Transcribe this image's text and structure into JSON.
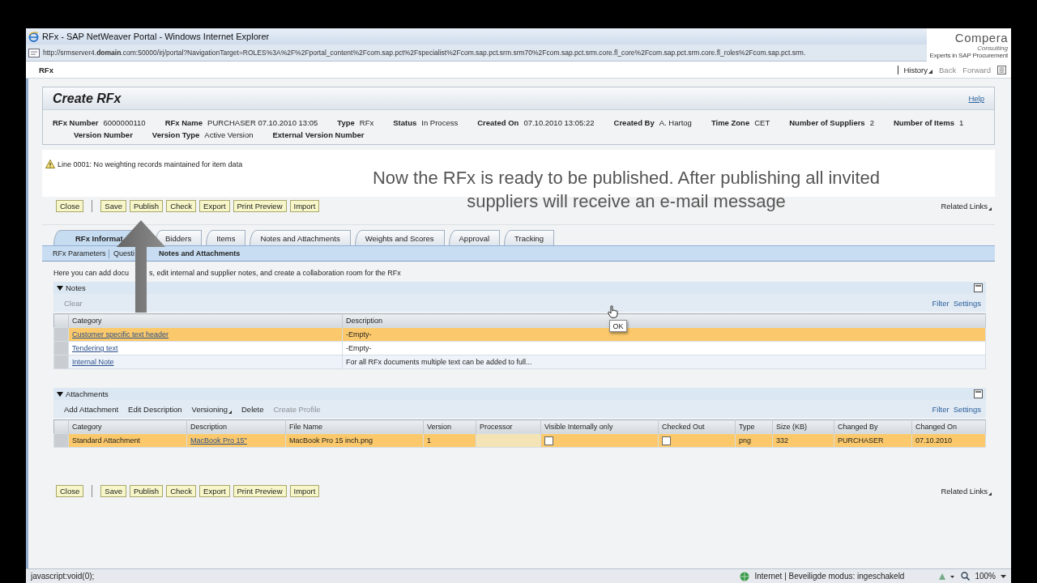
{
  "browser": {
    "title": "RFx - SAP NetWeaver Portal - Windows Internet Explorer",
    "address": "http://srmserver4.**domain**.com:50000/irj/portal?NavigationTarget=ROLES%3A%2F%2Fportal_content%2Fcom.sap.pct%2Fspecialist%2Fcom.sap.pct.srm.srm70%2Fcom.sap.pct.srm.core.fl_core%2Fcom.sap.pct.srm.core.fl_roles%2Fcom.sap.pct.srm.",
    "status_text": "javascript:void(0);",
    "zone": "Internet | Beveiligde modus: ingeschakeld",
    "zoom": "100%"
  },
  "logo": {
    "name": "Compera",
    "tagline": "Consulting",
    "subline": "Experts in SAP Procurement"
  },
  "portal": {
    "page": "RFx",
    "nav": [
      {
        "label": "History",
        "kind": "menu",
        "disabled": false
      },
      {
        "label": "Back",
        "kind": "link",
        "disabled": true
      },
      {
        "label": "Forward",
        "kind": "link",
        "disabled": true
      }
    ]
  },
  "header": {
    "title": "Create RFx",
    "help": "Help",
    "rows": [
      [
        {
          "label": "RFx Number",
          "value": "6000000110"
        },
        {
          "label": "RFx Name",
          "value": "PURCHASER 07.10.2010 13:05"
        },
        {
          "label": "Type",
          "value": "RFx"
        },
        {
          "label": "Status",
          "value": "In Process"
        },
        {
          "label": "Created On",
          "value": "07.10.2010 13:05:22"
        },
        {
          "label": "Created By",
          "value": "A. Hartog"
        },
        {
          "label": "Time Zone",
          "value": "CET"
        },
        {
          "label": "Number of Suppliers",
          "value": "2"
        },
        {
          "label": "Number of Items",
          "value": "1"
        }
      ],
      [
        {
          "label": "Version Number"
        },
        {
          "label": "Version Type",
          "value": "Active Version"
        },
        {
          "label": "External Version Number"
        }
      ]
    ]
  },
  "message": {
    "kind": "warning",
    "text": "Line 0001: No weighting records maintained for item data"
  },
  "caption": "Now the RFx is ready to be published. After publishing all invited suppliers will receive an e-mail message",
  "toolbar_top": {
    "buttons": [
      "Close",
      "Save",
      "Publish",
      "Check",
      "Export",
      "Print Preview",
      "Import"
    ],
    "related": "Related Links"
  },
  "tabs": [
    {
      "label": "RFx Informat",
      "selected": true
    },
    {
      "label": "Bidders",
      "selected": false
    },
    {
      "label": "Items",
      "selected": false
    },
    {
      "label": "Notes and Attachments",
      "selected": false
    },
    {
      "label": "Weights and Scores",
      "selected": false
    },
    {
      "label": "Approval",
      "selected": false
    },
    {
      "label": "Tracking",
      "selected": false
    }
  ],
  "subtabs": [
    {
      "label": "RFx Parameters",
      "selected": false
    },
    {
      "label": "Questi",
      "selected": false
    },
    {
      "label": "Notes and Attachments",
      "selected": true
    }
  ],
  "intro": [
    "Here you can add docu",
    "s, edit internal and supplier notes, and create a collaboration room for the RFx"
  ],
  "notes": {
    "title": "Notes",
    "expanded": true,
    "actions": [
      {
        "label": "Clear",
        "kind": "button",
        "disabled": true
      }
    ],
    "links": [
      "Filter",
      "Settings"
    ],
    "columns": [
      "Category",
      "Description"
    ],
    "rows": [
      {
        "selected": true,
        "cells": [
          {
            "kind": "link",
            "text": "Customer specific text header"
          },
          {
            "kind": "text",
            "text": "-Empty-"
          }
        ]
      },
      {
        "selected": false,
        "cells": [
          {
            "kind": "link",
            "text": "Tendering text"
          },
          {
            "kind": "text",
            "text": "-Empty-"
          }
        ]
      },
      {
        "selected": false,
        "cells": [
          {
            "kind": "link",
            "text": "Internal Note"
          },
          {
            "kind": "text",
            "text": "For all RFx documents multiple text can be added to full..."
          }
        ]
      }
    ]
  },
  "attachments": {
    "title": "Attachments",
    "expanded": true,
    "actions": [
      {
        "label": "Add Attachment",
        "kind": "button",
        "disabled": false
      },
      {
        "label": "Edit Description",
        "kind": "button",
        "disabled": false
      },
      {
        "label": "Versioning",
        "kind": "menu",
        "disabled": false
      },
      {
        "label": "Delete",
        "kind": "button",
        "disabled": false
      },
      {
        "label": "Create Profile",
        "kind": "button",
        "disabled": true
      }
    ],
    "links": [
      "Filter",
      "Settings"
    ],
    "columns": [
      "Category",
      "Description",
      "File Name",
      "Version",
      "Processor",
      "Visible Internally only",
      "Checked Out",
      "Type",
      "Size (KB)",
      "Changed By",
      "Changed On"
    ],
    "rows": [
      {
        "selected": true,
        "cells": [
          {
            "kind": "text",
            "text": "Standard Attachment"
          },
          {
            "kind": "link",
            "text": "MacBook Pro 15\""
          },
          {
            "kind": "text",
            "text": "MacBook Pro 15 inch.png"
          },
          {
            "kind": "text",
            "text": "1"
          },
          {
            "kind": "blank"
          },
          {
            "kind": "check",
            "checked": false
          },
          {
            "kind": "check",
            "checked": false
          },
          {
            "kind": "text",
            "text": "png"
          },
          {
            "kind": "text",
            "text": "332"
          },
          {
            "kind": "text",
            "text": "PURCHASER"
          },
          {
            "kind": "text",
            "text": "07.10.2010"
          }
        ]
      }
    ]
  },
  "toolbar_bottom": {
    "buttons": [
      "Close",
      "Save",
      "Publish",
      "Check",
      "Export",
      "Print Preview",
      "Import"
    ],
    "related": "Related Links"
  },
  "tooltip": "OK"
}
